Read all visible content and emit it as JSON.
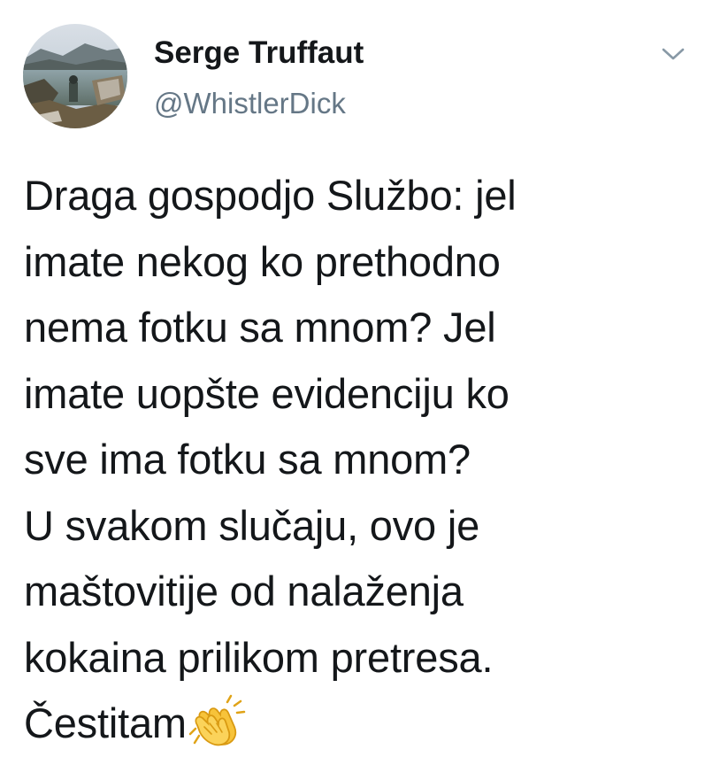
{
  "author": {
    "display_name": "Serge Truffaut",
    "handle": "@WhistlerDick"
  },
  "icons": {
    "avatar": "profile-photo-lakeside",
    "menu": "chevron-down-icon",
    "emoji": "clapping-hands-icon"
  },
  "tweet": {
    "lines": [
      "Draga gospodjo Službo: jel",
      "imate nekog ko prethodno",
      "nema fotku sa mnom? Jel",
      "imate uopšte evidenciju ko",
      "sve ima fotku sa mnom?",
      "U svakom slučaju, ovo je",
      "maštovitije od nalaženja",
      "kokaina prilikom pretresa.",
      "Čestitam"
    ]
  },
  "colors": {
    "text": "#14171a",
    "secondary": "#657786",
    "chevron": "#8899a6",
    "emoji": "#f7c33a"
  }
}
